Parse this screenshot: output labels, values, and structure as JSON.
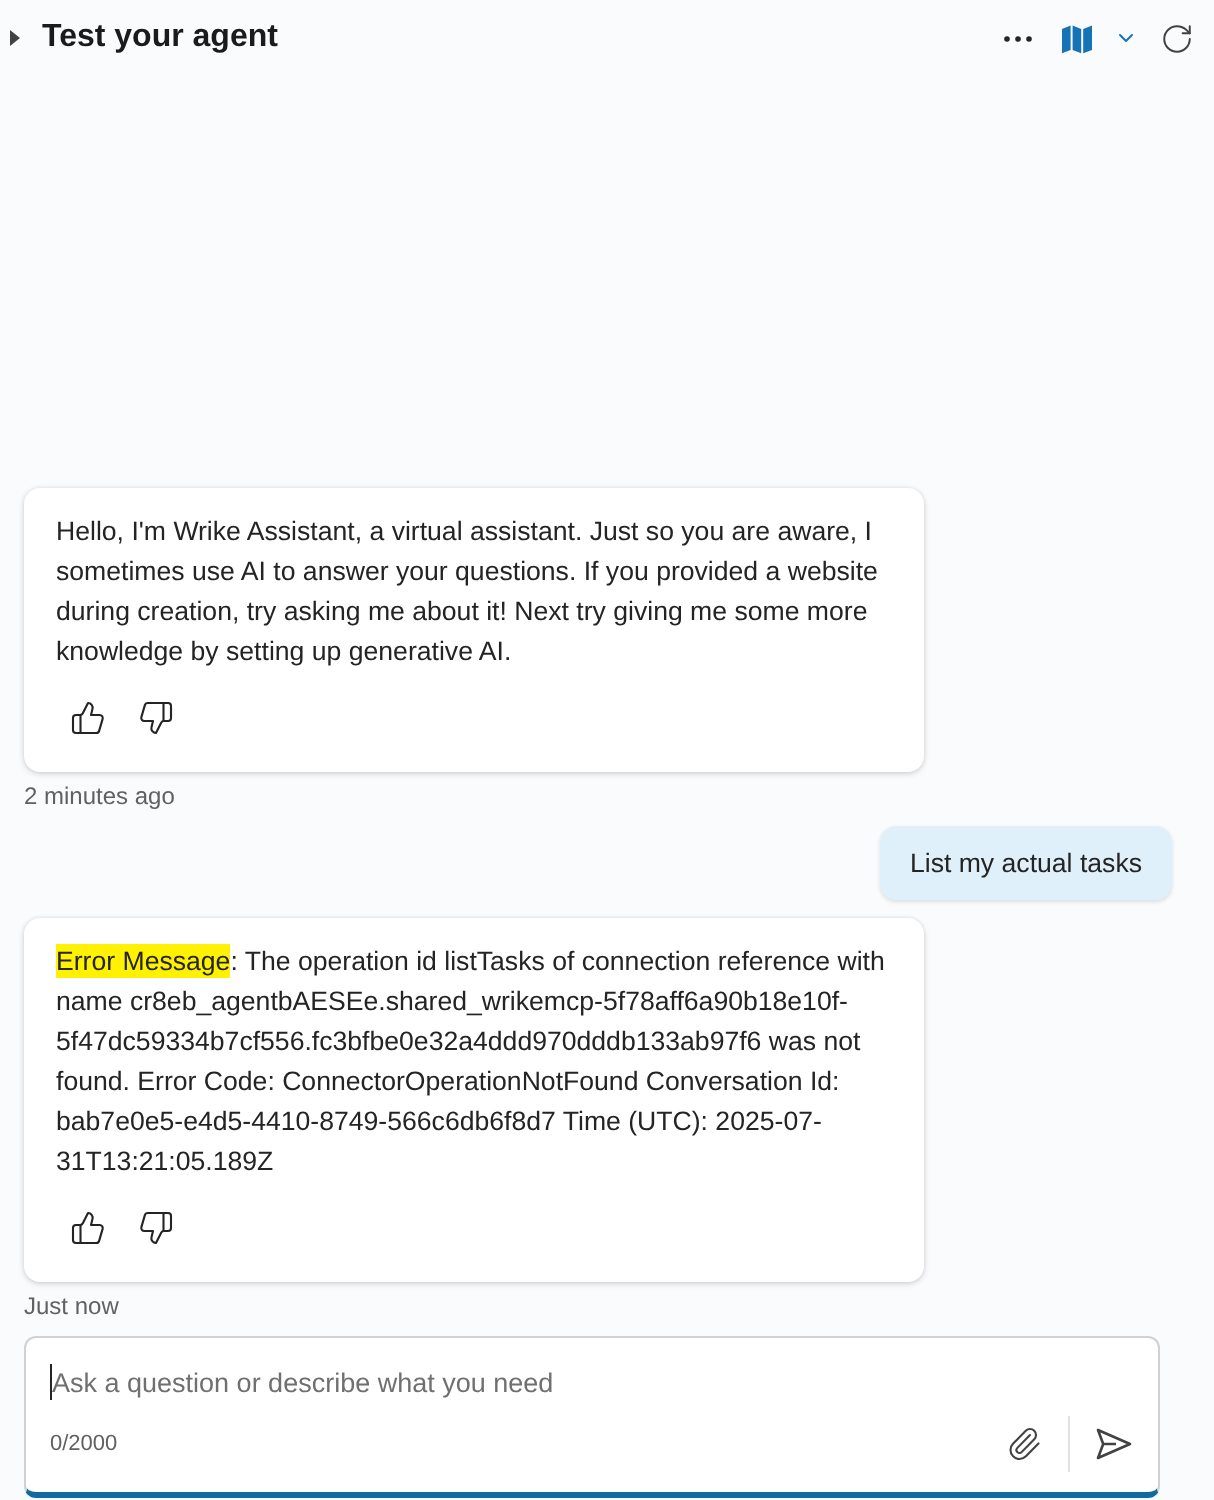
{
  "header": {
    "title": "Test your agent"
  },
  "messages": [
    {
      "kind": "bot",
      "segments": [
        {
          "text": "Hello, I'm Wrike Assistant, a virtual assistant. Just so you are aware, I sometimes use AI to answer your questions. If you provided a website during creation, try asking me about it! Next try giving me some more knowledge by setting up generative AI.",
          "highlighted": false
        }
      ],
      "timestamp": "2 minutes ago"
    },
    {
      "kind": "user",
      "segments": [
        {
          "text": "List my actual tasks",
          "highlighted": false
        }
      ]
    },
    {
      "kind": "bot",
      "segments": [
        {
          "text": "Error Message",
          "highlighted": true
        },
        {
          "text": ": The operation id listTasks of connection reference with name cr8eb_agentbAESEe.shared_wrikemcp-5f78aff6a90b18e10f-5f47dc59334b7cf556.fc3bfbe0e32a4ddd970dddb133ab97f6 was not found. Error Code: ConnectorOperationNotFound Conversation Id: bab7e0e5-e4d5-4410-8749-566c6db6f8d7 Time (UTC): 2025-07-31T13:21:05.189Z",
          "highlighted": false
        }
      ],
      "timestamp": "Just now"
    }
  ],
  "composer": {
    "placeholder": "Ask a question or describe what you need",
    "counter": "0/2000",
    "focused": true
  }
}
